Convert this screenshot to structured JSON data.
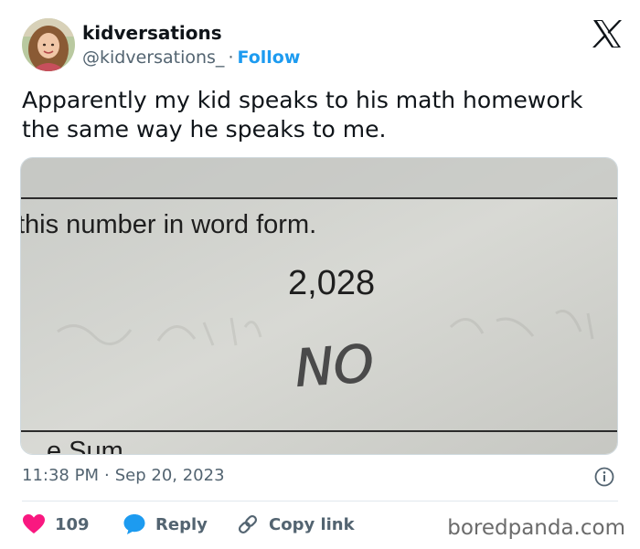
{
  "author": {
    "name": "kidversations",
    "handle": "@kidversations_",
    "separator": "·",
    "follow_label": "Follow"
  },
  "tweet": {
    "text": "Apparently my kid speaks to his math homework the same way he speaks to me."
  },
  "photo": {
    "prompt_text": "this number in word form.",
    "number": "2,028",
    "answer": "NO",
    "cutoff_text": "e Sum"
  },
  "meta": {
    "time": "11:38 PM",
    "dot": "·",
    "date": "Sep 20, 2023"
  },
  "actions": {
    "like_count": "109",
    "reply_label": "Reply",
    "copy_label": "Copy link"
  },
  "watermark": "boredpanda.com",
  "colors": {
    "accent": "#1d9bf0",
    "like": "#f91880",
    "text": "#0f1419",
    "muted": "#536471"
  },
  "icons": [
    "x-logo-icon",
    "info-icon",
    "heart-icon",
    "reply-bubble-icon",
    "link-icon"
  ]
}
